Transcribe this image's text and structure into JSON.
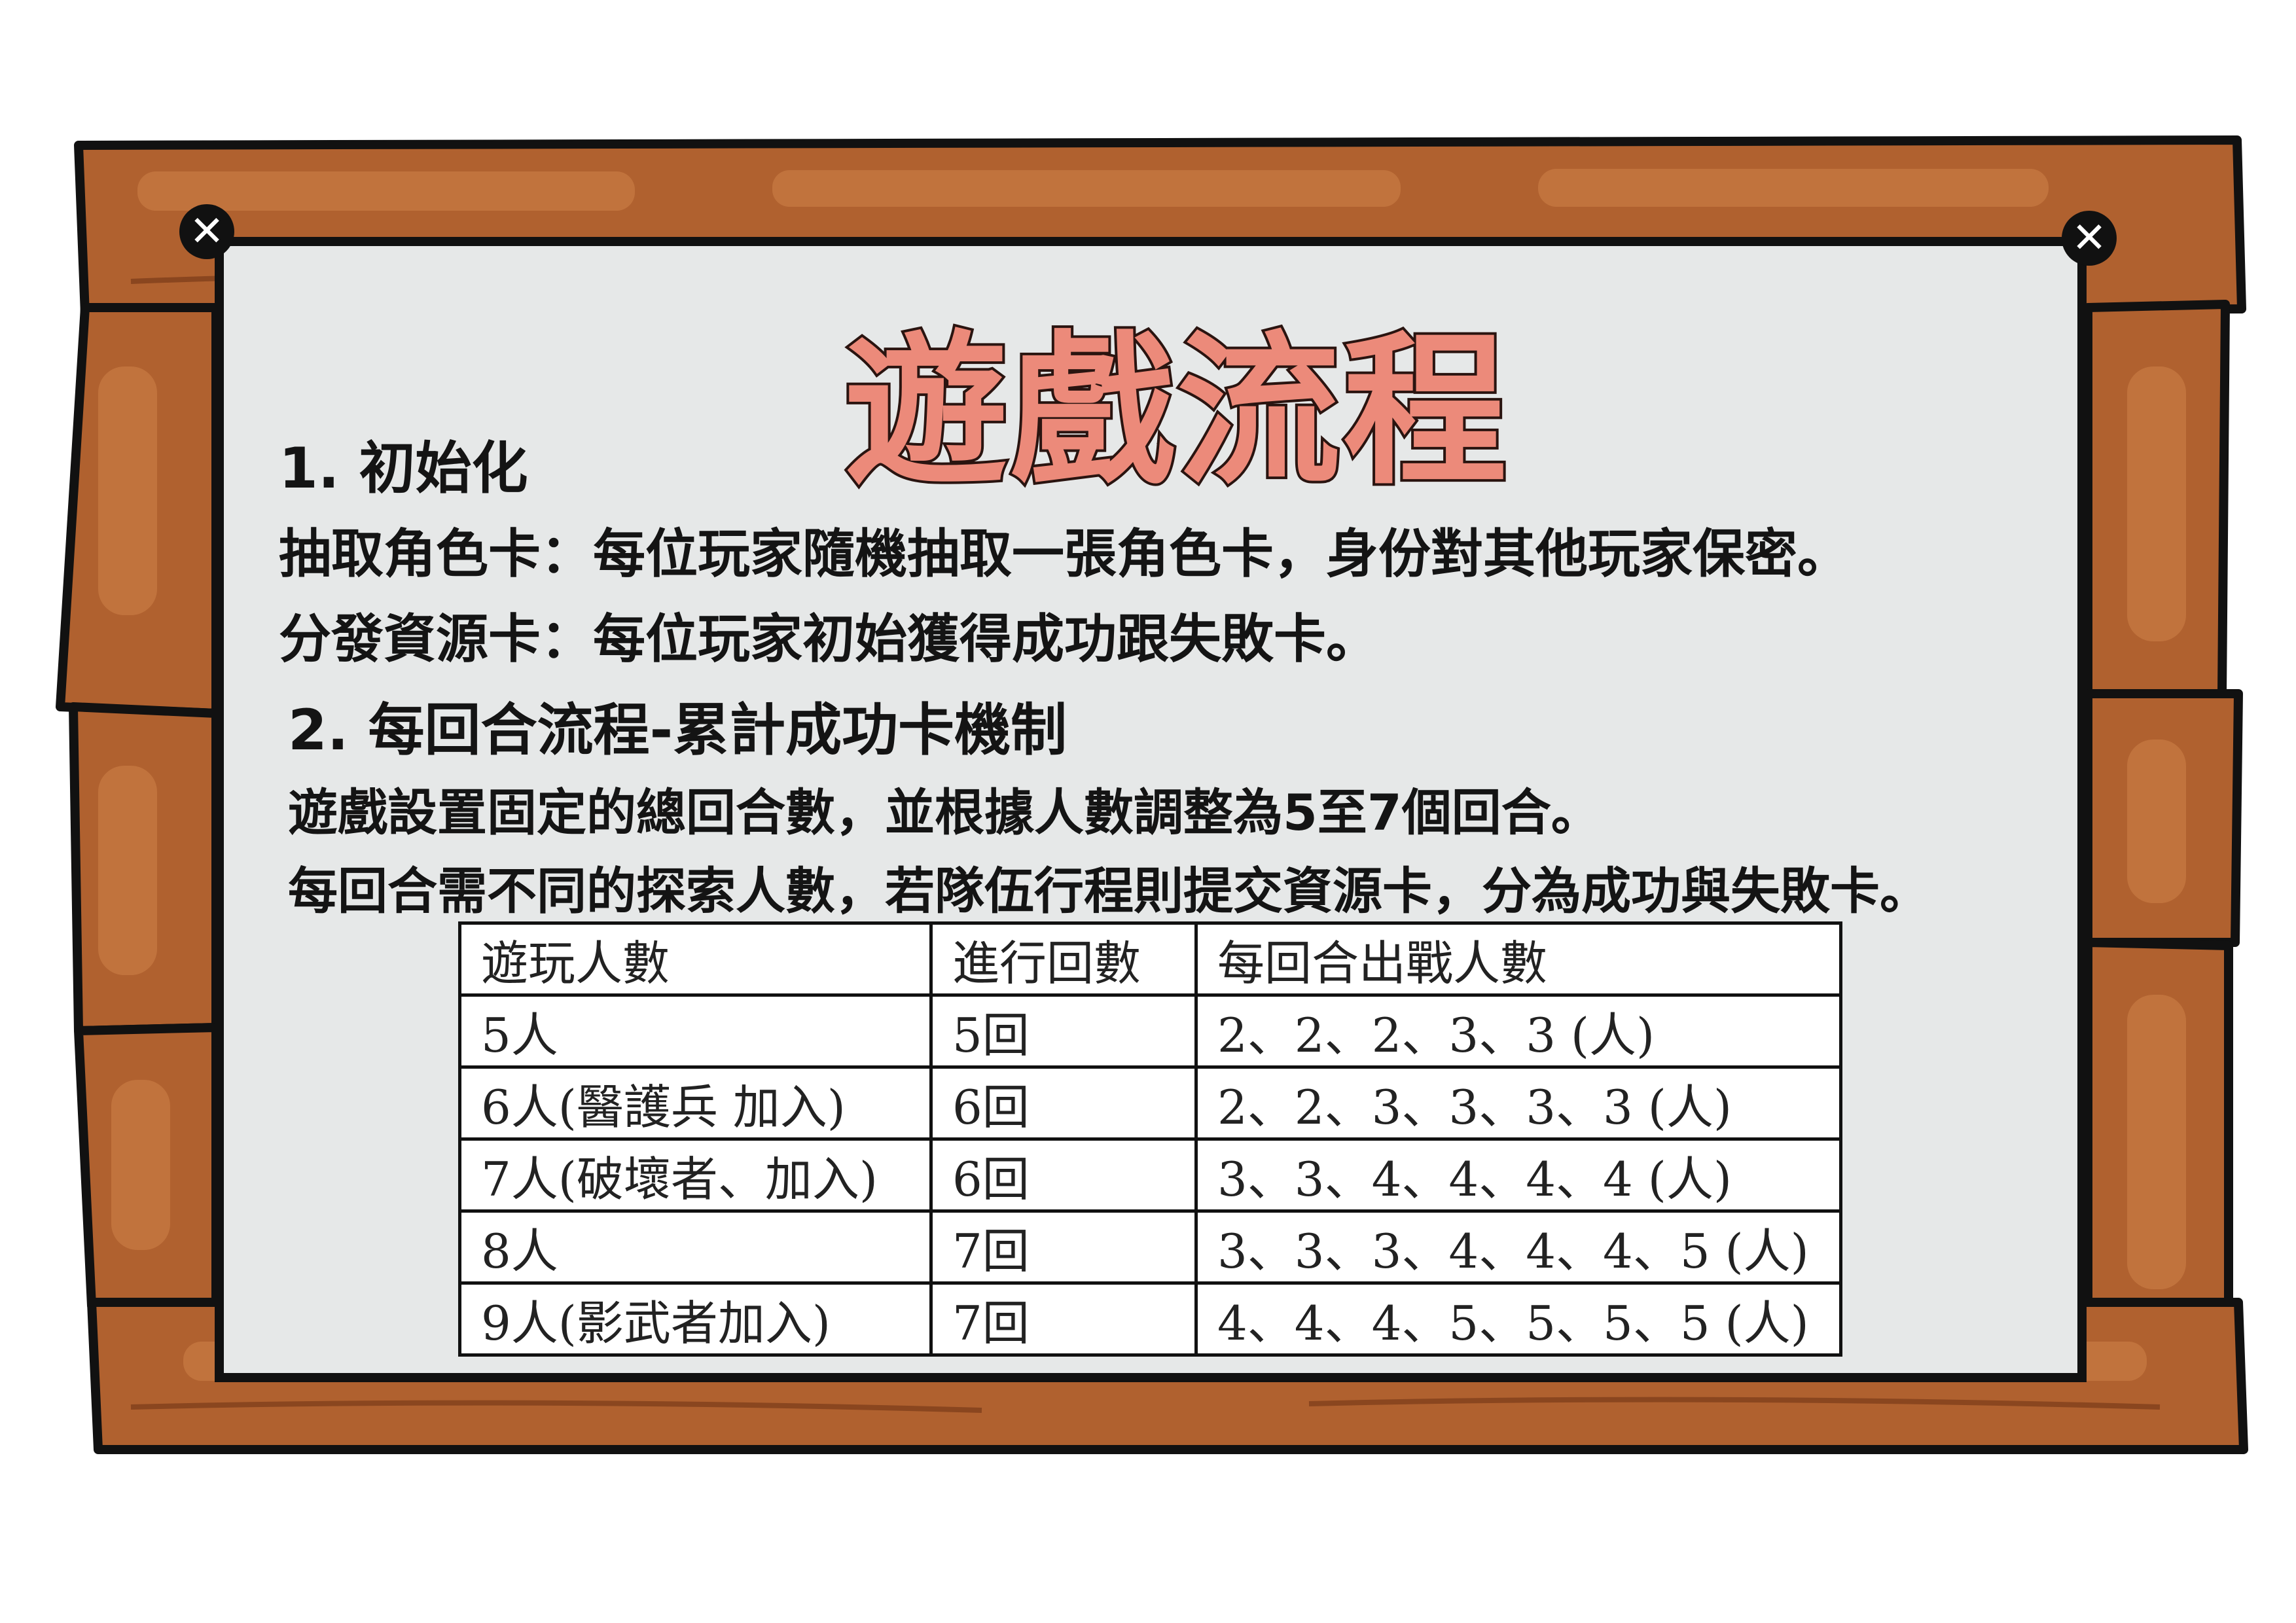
{
  "title": "遊戲流程",
  "section1": {
    "heading": "1. 初始化",
    "line1": "抽取角色卡：每位玩家隨機抽取一張角色卡，身份對其他玩家保密。",
    "line2": "分發資源卡：每位玩家初始獲得成功跟失敗卡。"
  },
  "section2": {
    "heading": "2. 每回合流程-累計成功卡機制",
    "line1": "遊戲設置固定的總回合數，並根據人數調整為5至7個回合。",
    "line2": "每回合需不同的探索人數，若隊伍行程則提交資源卡，分為成功與失敗卡。"
  },
  "table": {
    "headers": [
      "遊玩人數",
      "進行回數",
      "每回合出戰人數"
    ],
    "rows": [
      [
        "5人",
        "5回",
        "2、2、2、3、3 (人)"
      ],
      [
        "6人(醫護兵 加入)",
        "6回",
        "2、2、3、3、3、3 (人)"
      ],
      [
        "7人(破壞者、加入)",
        "6回",
        "3、3、4、4、4、4 (人)"
      ],
      [
        "8人",
        "7回",
        "3、3、3、4、4、4、5 (人)"
      ],
      [
        "9人(影武者加入)",
        "7回",
        "4、4、4、5、5、5、5 (人)"
      ]
    ]
  },
  "colors": {
    "wood": "#b0612f",
    "wood_highlight": "#c4773f",
    "paper": "#e6e8e8",
    "title_fill": "#ec8a7a",
    "outline": "#111111"
  },
  "icons": [
    "screw-icon",
    "screw-icon"
  ]
}
